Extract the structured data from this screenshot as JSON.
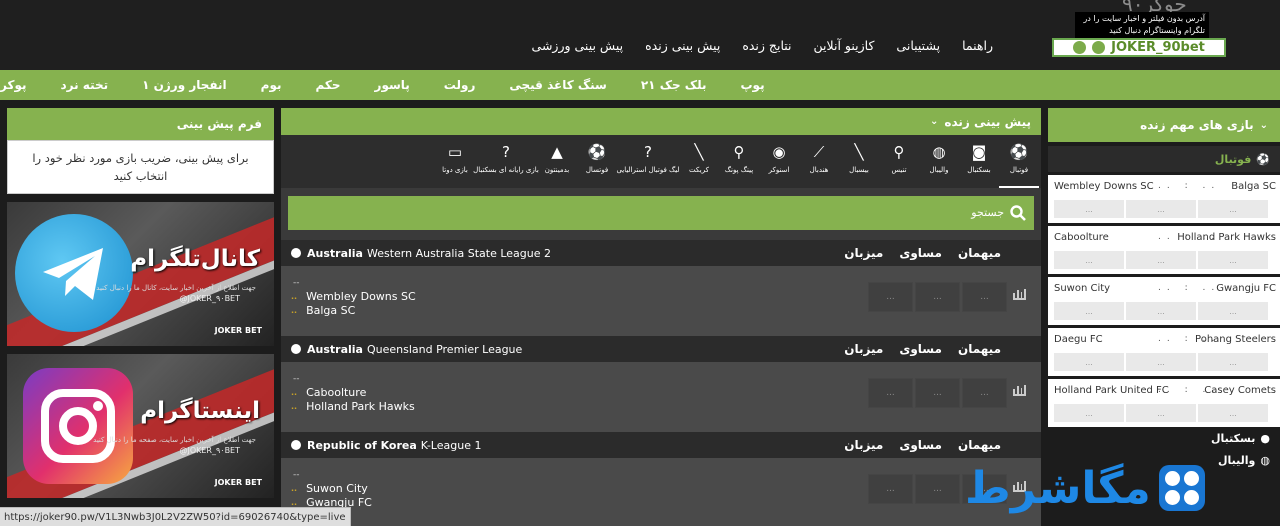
{
  "header": {
    "logo_wordmark": "جوکر۹۰",
    "logo_note": "آدرس بدون فیلتر و اخبار سایت را در تلگرام واینستاگرام دنبال کنید",
    "logo_handle": "JOKER_90bet",
    "nav": [
      "پیش بینی ورزشی",
      "پیش بینی زنده",
      "نتایج زنده",
      "کازینو آنلاین",
      "پشتیبانی",
      "راهنما"
    ]
  },
  "casino_nav": [
    "پوکر",
    "تخته نرد",
    "انفجار ورژن ۱",
    "بوم",
    "حکم",
    "پاسور",
    "رولت",
    "سنگ کاغذ قیچی",
    "بلک جک ۲۱",
    "پوپ"
  ],
  "left": {
    "form_title": "فرم پیش بینی",
    "form_text": "برای پیش بینی، ضریب بازی مورد نظر خود را انتخاب کنید",
    "telegram": {
      "title": "کانال‌تلگرام",
      "sub": "جهت اطلاع از آخرین اخبار سایت، کانال ما را دنبال کنید",
      "handle": "@JOKER_۹۰BET",
      "foot": "JOKER BET"
    },
    "instagram": {
      "title": "اینستاگرام",
      "sub": "جهت اطلاع از آخرین اخبار سایت، صفحه ما را دنبال کنید",
      "handle": "@JOKER_۹۰BET",
      "foot": "JOKER BET"
    }
  },
  "center": {
    "title": "پیش بینی زنده",
    "sports": [
      {
        "label": "فوتبال",
        "icon": "soccer-ball-icon",
        "glyph": "⚽"
      },
      {
        "label": "بسکتبال",
        "icon": "basketball-icon",
        "glyph": "◙"
      },
      {
        "label": "والیبال",
        "icon": "volleyball-icon",
        "glyph": "◍"
      },
      {
        "label": "تنیس",
        "icon": "tennis-racket-icon",
        "glyph": "⚲"
      },
      {
        "label": "بیسبال",
        "icon": "baseball-bat-icon",
        "glyph": "╲"
      },
      {
        "label": "هندبال",
        "icon": "handball-icon",
        "glyph": "⟋"
      },
      {
        "label": "اسنوکر",
        "icon": "snooker-ball-icon",
        "glyph": "◉"
      },
      {
        "label": "پینگ پونگ",
        "icon": "ping-pong-icon",
        "glyph": "⚲"
      },
      {
        "label": "کریکت",
        "icon": "cricket-bat-icon",
        "glyph": "╲"
      },
      {
        "label": "لیگ فوتبال استرالیایی",
        "icon": "aussie-rules-icon",
        "glyph": "?",
        "wide": true
      },
      {
        "label": "فوتسال",
        "icon": "futsal-icon",
        "glyph": "⚽"
      },
      {
        "label": "بدمینتون",
        "icon": "badminton-icon",
        "glyph": "▲"
      },
      {
        "label": "بازی رایانه ای بسکتبال",
        "icon": "esports-basketball-icon",
        "glyph": "?",
        "wide": true
      },
      {
        "label": "بازی دوتا",
        "icon": "dota-game-icon",
        "glyph": "▭"
      }
    ],
    "search_placeholder": "جستجو",
    "columns": [
      "میزبان",
      "مساوی",
      "میهمان"
    ],
    "leagues": [
      {
        "country": "Australia",
        "name": "Western Australia State League 2",
        "home": "Wembley Downs SC",
        "away": "Balga SC",
        "dash": "--",
        "odds": [
          "...",
          "...",
          "..."
        ]
      },
      {
        "country": "Australia",
        "name": "Queensland Premier League",
        "home": "Caboolture",
        "away": "Holland Park Hawks",
        "dash": "--",
        "odds": [
          "...",
          "...",
          "..."
        ]
      },
      {
        "country": "Republic of Korea",
        "name": "K-League 1",
        "home": "Suwon City",
        "away": "Gwangju FC",
        "dash": "--",
        "odds": [
          "...",
          "...",
          "..."
        ]
      }
    ]
  },
  "right": {
    "title": "بازی های مهم زنده",
    "sport": "فوتبال",
    "matches": [
      {
        "home": "Wembley Downs SC",
        "away": "Balga SC"
      },
      {
        "home": "Caboolture",
        "away": "Holland Park Hawks"
      },
      {
        "home": "Suwon City",
        "away": "Gwangju FC"
      },
      {
        "home": "Daegu FC",
        "away": "Pohang Steelers"
      },
      {
        "home": "Holland Park United FC",
        "away": "Casey Comets"
      }
    ],
    "score_sep": ".. : ..",
    "odd_placeholder": "...",
    "categories": [
      "بسکتبال",
      "والیبال"
    ]
  },
  "status_url": "https://joker90.pw/V1L3Nwb3J0L2V2ZW50?id=69026740&type=live",
  "watermark": "مگاشرط"
}
